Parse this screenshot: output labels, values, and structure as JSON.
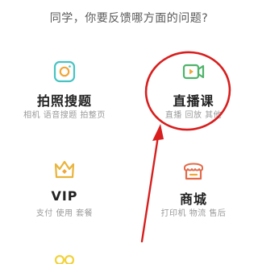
{
  "prompt": "同学，你要反馈哪方面的问题?",
  "tiles": [
    {
      "title": "拍照搜题",
      "sub": "相机 语音搜题 拍整页",
      "icon": "camera-icon",
      "color": "#48c3c3"
    },
    {
      "title": "直播课",
      "sub": "直播 回放 其他",
      "icon": "video-camera-icon",
      "color": "#4fb36a"
    },
    {
      "title": "VIP",
      "sub": "支付 使用 套餐",
      "icon": "crown-icon",
      "color": "#e9b43a"
    },
    {
      "title": "商城",
      "sub": "打印机 物流 售后",
      "icon": "shop-icon",
      "color": "#e36a4a"
    }
  ],
  "annotation": {
    "circle_color": "#d81e1e",
    "arrow_color": "#d81e1e"
  },
  "partial_icon": {
    "icon": "partial-yellow-icon",
    "color": "#f2d23a"
  }
}
